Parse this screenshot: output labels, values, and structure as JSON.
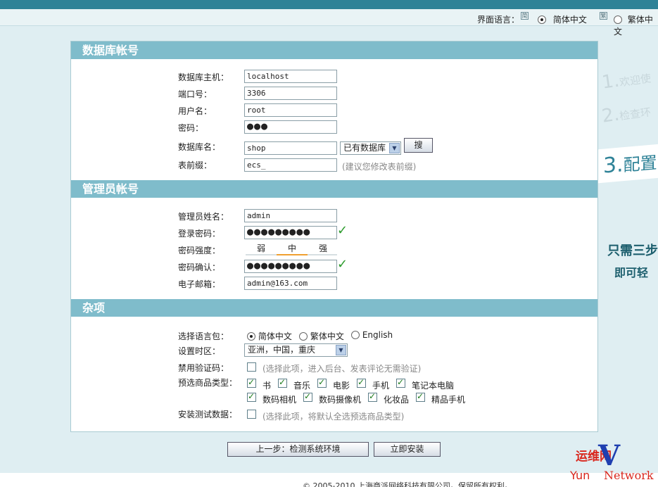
{
  "lang_bar": {
    "label": "界面语言：",
    "options": [
      {
        "label": "简体中文",
        "selected": true
      },
      {
        "label": "繁体中文",
        "selected": false
      }
    ]
  },
  "steps": {
    "s1_num": "1.",
    "s1_text": "欢迎使",
    "s2_num": "2.",
    "s2_text": "检查环",
    "s3_num": "3.",
    "s3_text": "配置"
  },
  "promo": {
    "line1": "只需三步",
    "line2": "即可轻"
  },
  "db": {
    "title": "数据库帐号",
    "host_label": "数据库主机：",
    "host": "localhost",
    "port_label": "端口号：",
    "port": "3306",
    "user_label": "用户名：",
    "user": "root",
    "pass_label": "密码：",
    "pass": "●●●",
    "name_label": "数据库名：",
    "name": "shop",
    "existing_db": "已有数据库",
    "search_button": "搜",
    "prefix_label": "表前缀：",
    "prefix": "ecs_",
    "prefix_hint": "(建议您修改表前缀)"
  },
  "admin": {
    "title": "管理员帐号",
    "name_label": "管理员姓名：",
    "name": "admin",
    "pass_label": "登录密码：",
    "pass": "●●●●●●●●●",
    "strength_label": "密码强度：",
    "strength": [
      "弱",
      "中",
      "强"
    ],
    "confirm_label": "密码确认：",
    "confirm": "●●●●●●●●●",
    "email_label": "电子邮箱：",
    "email": "admin@163.com"
  },
  "misc": {
    "title": "杂项",
    "lang_label": "选择语言包：",
    "lang_options": [
      {
        "label": "简体中文",
        "selected": true
      },
      {
        "label": "繁体中文",
        "selected": false
      },
      {
        "label": "English",
        "selected": false
      }
    ],
    "tz_label": "设置时区：",
    "tz": "亚洲，中国，重庆",
    "captcha_label": "禁用验证码：",
    "captcha_hint": "(选择此项，进入后台、发表评论无需验证)",
    "goods_label": "预选商品类型：",
    "goods_row1": [
      "书",
      "音乐",
      "电影",
      "手机",
      "笔记本电脑"
    ],
    "goods_row2": [
      "数码相机",
      "数码摄像机",
      "化妆品",
      "精品手机"
    ],
    "test_label": "安装测试数据：",
    "test_hint": "(选择此项，将默认全选预选商品类型)"
  },
  "buttons": {
    "prev": "上一步：检测系统环境",
    "install": "立即安装"
  },
  "footer": "© 2005-2010 上海商派网络科技有限公司。保留所有权利。",
  "watermark": {
    "line1": "运维网",
    "line2_a": "Yun",
    "line2_b": "Network"
  },
  "colors": {
    "header": "#2e8297",
    "section": "#7fbccb",
    "check": "#2c9b2c",
    "accent": "#f0a030"
  }
}
